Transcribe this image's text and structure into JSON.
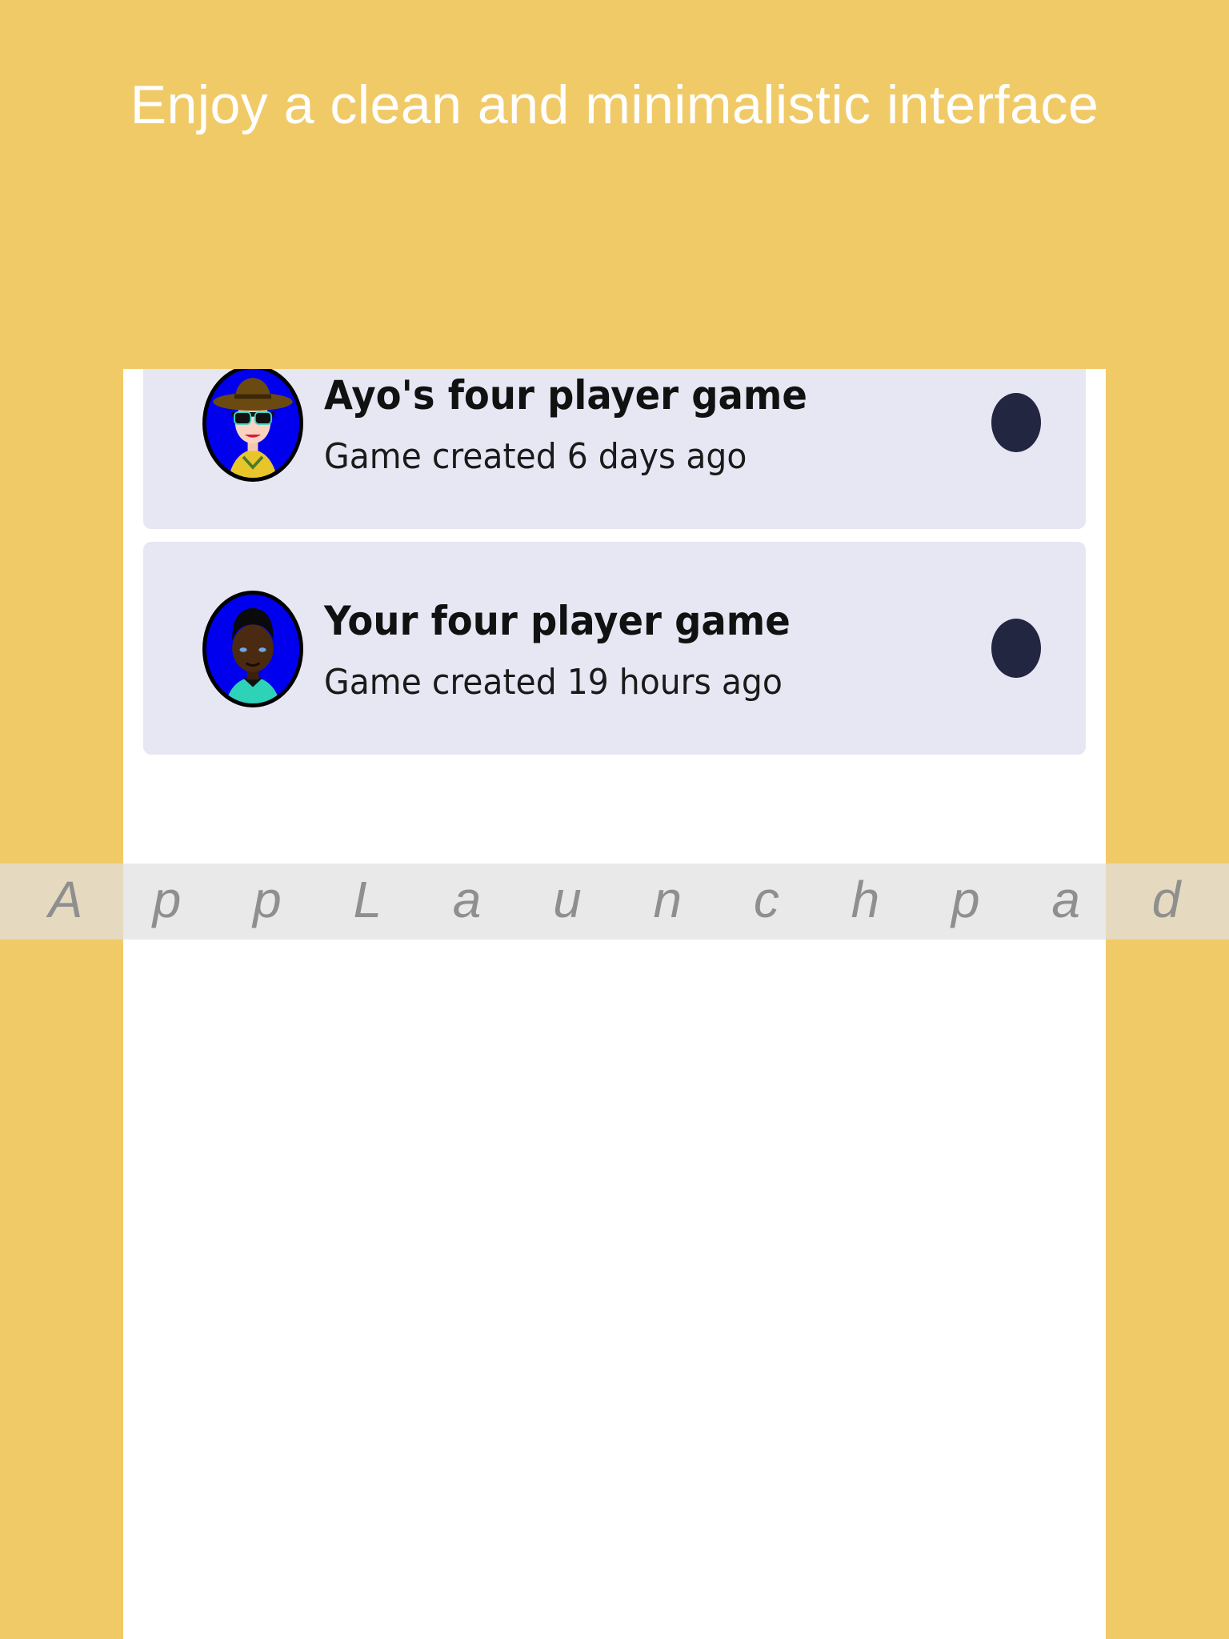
{
  "colors": {
    "background": "#F1CA68",
    "card_background": "#E6E7F3",
    "status_dot": "#222641",
    "avatar_ring": "#0000EE"
  },
  "headline": "Enjoy a clean and minimalistic interface",
  "games": [
    {
      "title": "Ayo's four player game",
      "subtitle": "Game created 6 days ago",
      "avatar_icon": "man-with-hat-and-sunglasses-avatar-icon"
    },
    {
      "title": "Your four player game",
      "subtitle": "Game created 19 hours ago",
      "avatar_icon": "man-with-dark-hair-avatar-icon"
    }
  ],
  "watermark": "A p p L a u n c h p a d"
}
